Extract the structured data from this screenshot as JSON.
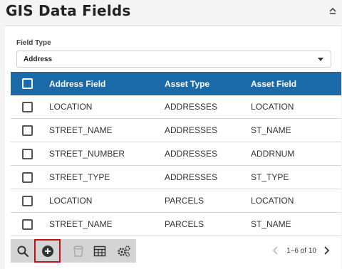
{
  "header": {
    "title": "GIS Data Fields"
  },
  "field_type": {
    "label": "Field Type",
    "value": "Address"
  },
  "table": {
    "columns": [
      "Address Field",
      "Asset Type",
      "Asset Field"
    ],
    "rows": [
      [
        "LOCATION",
        "ADDRESSES",
        "LOCATION"
      ],
      [
        "STREET_NAME",
        "ADDRESSES",
        "ST_NAME"
      ],
      [
        "STREET_NUMBER",
        "ADDRESSES",
        "ADDRNUM"
      ],
      [
        "STREET_TYPE",
        "ADDRESSES",
        "ST_TYPE"
      ],
      [
        "LOCATION",
        "PARCELS",
        "LOCATION"
      ],
      [
        "STREET_NAME",
        "PARCELS",
        "ST_NAME"
      ]
    ]
  },
  "toolbar": {
    "icons": [
      "search-icon",
      "add-icon",
      "delete-icon",
      "table-icon",
      "settings-icon"
    ]
  },
  "pagination": {
    "text": "1–6 of 10"
  },
  "colors": {
    "header_bg": "#1a6aaa",
    "highlight": "#c0121d",
    "toolbar_bg": "#d4d4d4"
  }
}
